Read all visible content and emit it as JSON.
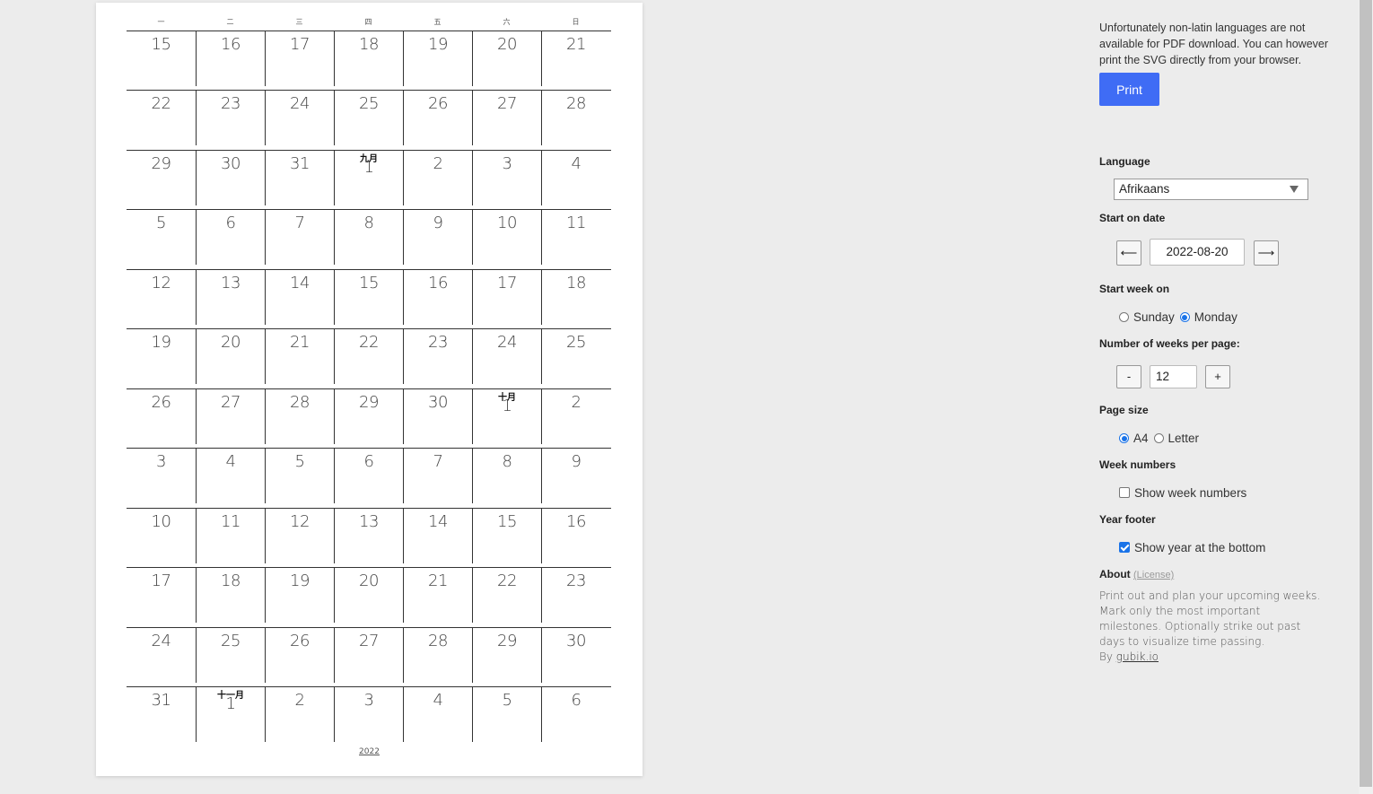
{
  "calendar": {
    "weekdays": [
      "一",
      "二",
      "三",
      "四",
      "五",
      "六",
      "日"
    ],
    "weeks": [
      [
        {
          "d": "15"
        },
        {
          "d": "16"
        },
        {
          "d": "17"
        },
        {
          "d": "18"
        },
        {
          "d": "19"
        },
        {
          "d": "20"
        },
        {
          "d": "21"
        }
      ],
      [
        {
          "d": "22"
        },
        {
          "d": "23"
        },
        {
          "d": "24"
        },
        {
          "d": "25"
        },
        {
          "d": "26"
        },
        {
          "d": "27"
        },
        {
          "d": "28"
        }
      ],
      [
        {
          "d": "29"
        },
        {
          "d": "30"
        },
        {
          "d": "31"
        },
        {
          "d": "1",
          "m": "九月"
        },
        {
          "d": "2"
        },
        {
          "d": "3"
        },
        {
          "d": "4"
        }
      ],
      [
        {
          "d": "5"
        },
        {
          "d": "6"
        },
        {
          "d": "7"
        },
        {
          "d": "8"
        },
        {
          "d": "9"
        },
        {
          "d": "10"
        },
        {
          "d": "11"
        }
      ],
      [
        {
          "d": "12"
        },
        {
          "d": "13"
        },
        {
          "d": "14"
        },
        {
          "d": "15"
        },
        {
          "d": "16"
        },
        {
          "d": "17"
        },
        {
          "d": "18"
        }
      ],
      [
        {
          "d": "19"
        },
        {
          "d": "20"
        },
        {
          "d": "21"
        },
        {
          "d": "22"
        },
        {
          "d": "23"
        },
        {
          "d": "24"
        },
        {
          "d": "25"
        }
      ],
      [
        {
          "d": "26"
        },
        {
          "d": "27"
        },
        {
          "d": "28"
        },
        {
          "d": "29"
        },
        {
          "d": "30"
        },
        {
          "d": "1",
          "m": "十月"
        },
        {
          "d": "2"
        }
      ],
      [
        {
          "d": "3"
        },
        {
          "d": "4"
        },
        {
          "d": "5"
        },
        {
          "d": "6"
        },
        {
          "d": "7"
        },
        {
          "d": "8"
        },
        {
          "d": "9"
        }
      ],
      [
        {
          "d": "10"
        },
        {
          "d": "11"
        },
        {
          "d": "12"
        },
        {
          "d": "13"
        },
        {
          "d": "14"
        },
        {
          "d": "15"
        },
        {
          "d": "16"
        }
      ],
      [
        {
          "d": "17"
        },
        {
          "d": "18"
        },
        {
          "d": "19"
        },
        {
          "d": "20"
        },
        {
          "d": "21"
        },
        {
          "d": "22"
        },
        {
          "d": "23"
        }
      ],
      [
        {
          "d": "24"
        },
        {
          "d": "25"
        },
        {
          "d": "26"
        },
        {
          "d": "27"
        },
        {
          "d": "28"
        },
        {
          "d": "29"
        },
        {
          "d": "30"
        }
      ],
      [
        {
          "d": "31"
        },
        {
          "d": "1",
          "m": "十一月"
        },
        {
          "d": "2"
        },
        {
          "d": "3"
        },
        {
          "d": "4"
        },
        {
          "d": "5"
        },
        {
          "d": "6"
        }
      ]
    ],
    "year_footer": "2022"
  },
  "panel": {
    "notice": "Unfortunately non-latin languages are not available for PDF download. You can however print the SVG directly from your browser.",
    "print_label": "Print",
    "language_label": "Language",
    "language_value": "Afrikaans",
    "start_date_label": "Start on date",
    "prev_arrow": "⟵",
    "next_arrow": "⟶",
    "start_date_value": "2022-08-20",
    "start_week_label": "Start week on",
    "sunday_label": "Sunday",
    "monday_label": "Monday",
    "weeks_per_page_label": "Number of weeks per page:",
    "minus_label": "-",
    "plus_label": "+",
    "weeks_per_page_value": "12",
    "page_size_label": "Page size",
    "a4_label": "A4",
    "letter_label": "Letter",
    "week_numbers_label": "Week numbers",
    "show_week_numbers_label": "Show week numbers",
    "year_footer_label": "Year footer",
    "show_year_label": "Show year at the bottom",
    "about_label": "About",
    "license_label": "(License)",
    "about_text": "Print out and plan your upcoming weeks. Mark only the most important milestones. Optionally strike out past days to visualize time passing.",
    "by_label": "By",
    "author_link": "gubik.io"
  },
  "state": {
    "start_week": "monday",
    "page_size": "A4",
    "show_week_numbers": false,
    "show_year": true
  }
}
